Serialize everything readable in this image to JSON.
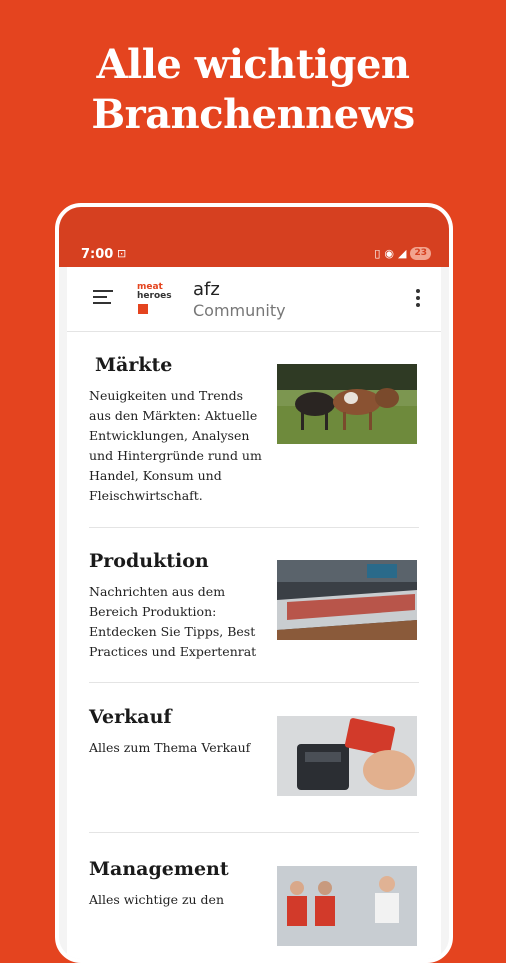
{
  "headline": {
    "line1": "Alle wichtigen",
    "line2": "Branchennews"
  },
  "status_bar": {
    "time": "7:00",
    "battery": "23"
  },
  "app_bar": {
    "logo_line1": "meat",
    "logo_line2": "heroes",
    "title": "afz",
    "subtitle": "Community"
  },
  "colors": {
    "brand": "#E4441F",
    "status_bar": "#D64020"
  },
  "items": [
    {
      "title": "Märkte",
      "description": "Neuigkeiten und Trends aus den Märkten: Aktuelle Entwicklungen, Analysen und Hintergründe rund um Handel, Konsum und Fleischwirtschaft.",
      "image": "cows-on-pasture"
    },
    {
      "title": "Produktion",
      "description": "Nachrichten aus dem Bereich Produktion: Entdecken Sie Tipps, Best Practices und Expertenrat",
      "image": "meat-counter"
    },
    {
      "title": "Verkauf",
      "description": "Alles zum Thema Verkauf",
      "image": "card-payment"
    },
    {
      "title": "Management",
      "description": "Alles wichtige zu den",
      "image": "team-photo"
    }
  ]
}
